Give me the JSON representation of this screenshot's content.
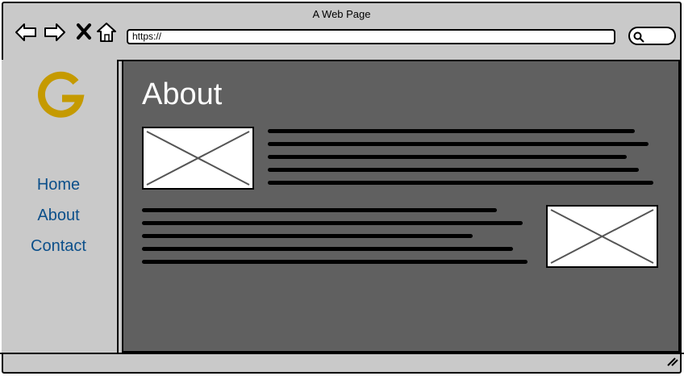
{
  "window": {
    "title": "A Web Page"
  },
  "toolbar": {
    "url": "https://"
  },
  "icons": {
    "back": "arrow-left-icon",
    "forward": "arrow-right-icon",
    "close": "close-icon",
    "home": "home-icon",
    "search": "search-icon",
    "logo": "g-logo-icon",
    "resize": "resize-grip-icon"
  },
  "sidebar": {
    "items": [
      {
        "label": "Home"
      },
      {
        "label": "About"
      },
      {
        "label": "Contact"
      }
    ]
  },
  "main": {
    "heading": "About"
  },
  "colors": {
    "chrome": "#c9c9c9",
    "content_bg": "#606060",
    "nav_link": "#0b4f8a",
    "logo": "#c59a00",
    "heading": "#ffffff"
  }
}
